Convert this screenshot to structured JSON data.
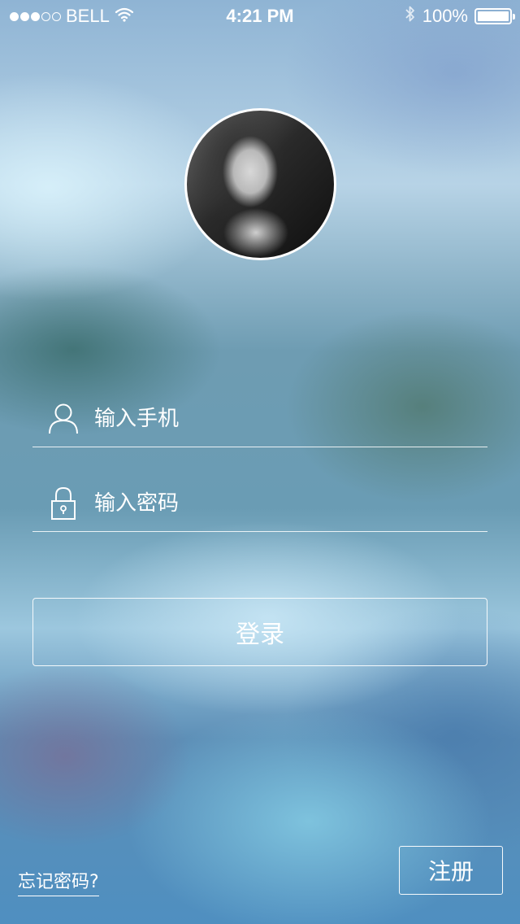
{
  "status_bar": {
    "carrier": "BELL",
    "time": "4:21 PM",
    "battery_percent": "100%",
    "battery_level": 1.0,
    "signal_bars_filled": 3,
    "signal_bars_total": 5,
    "icons": [
      "wifi-icon",
      "bluetooth-icon",
      "battery-icon"
    ]
  },
  "profile": {
    "avatar_icon": "user-avatar-photo"
  },
  "form": {
    "phone": {
      "placeholder": "输入手机",
      "value": "",
      "icon": "user-icon"
    },
    "password": {
      "placeholder": "输入密码",
      "value": "",
      "icon": "lock-icon"
    },
    "login_label": "登录"
  },
  "footer": {
    "forgot_label": "忘记密码?",
    "register_label": "注册"
  },
  "colors": {
    "foreground": "#ffffff",
    "background_accent": "#6a9cb4"
  }
}
